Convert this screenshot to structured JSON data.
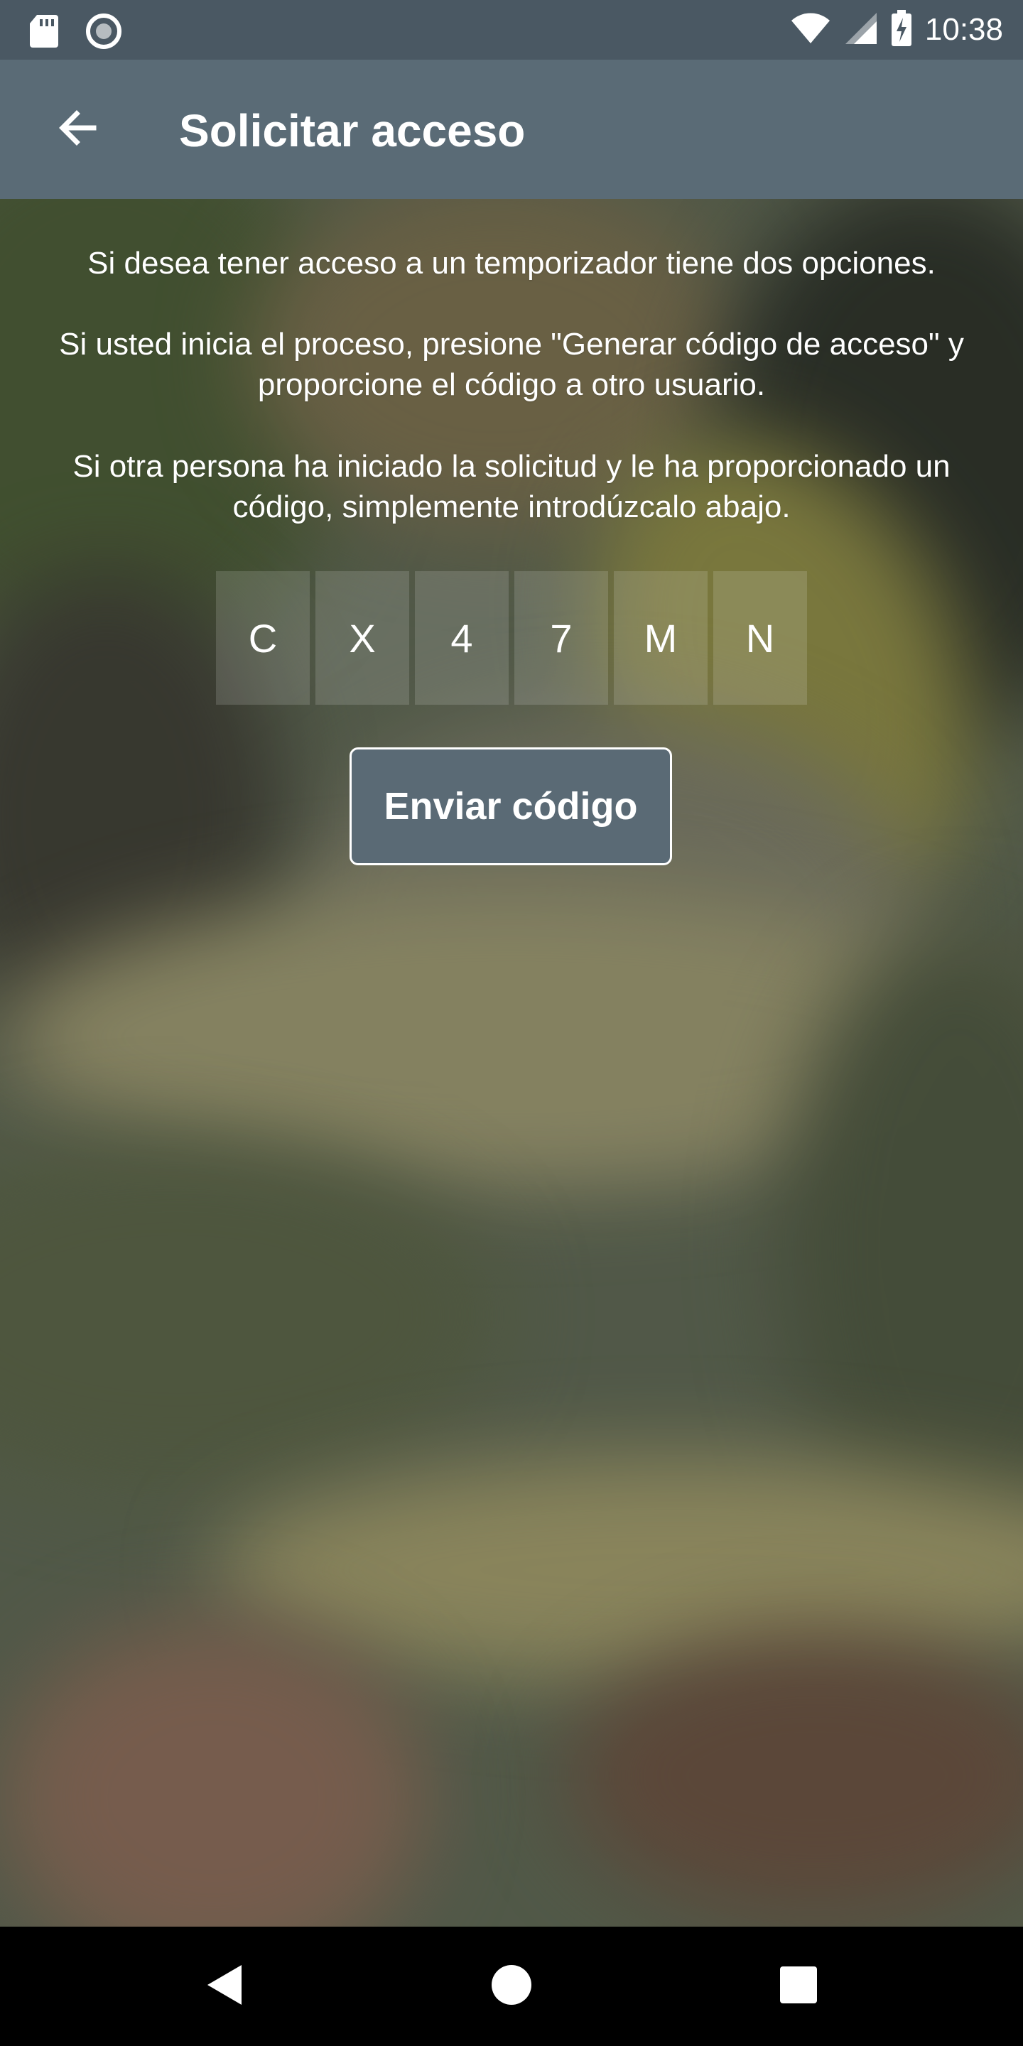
{
  "status_bar": {
    "time": "10:38",
    "icons": [
      "sd-card-icon",
      "sync-circle-icon",
      "wifi-icon",
      "cell-signal-icon",
      "battery-charging-icon"
    ]
  },
  "app_bar": {
    "title": "Solicitar acceso",
    "back_icon": "arrow-back-icon"
  },
  "content": {
    "paragraph_1": "Si desea tener acceso a un temporizador tiene dos opciones.",
    "paragraph_2": "Si usted inicia el proceso, presione \"Generar código de acceso\" y proporcione el código a otro usuario.",
    "paragraph_3": "Si otra persona ha iniciado la solicitud y le ha proporcionado un código, simplemente introdúzcalo abajo.",
    "code": [
      "C",
      "X",
      "4",
      "7",
      "M",
      "N"
    ],
    "send_button_label": "Enviar código"
  },
  "nav_bar": {
    "icons": [
      "nav-back-icon",
      "nav-home-icon",
      "nav-recents-icon"
    ]
  },
  "colors": {
    "status_bar": "#4a5863",
    "app_bar": "#5a6b76",
    "button": "#5a6a75",
    "nav_bar": "#000000"
  }
}
